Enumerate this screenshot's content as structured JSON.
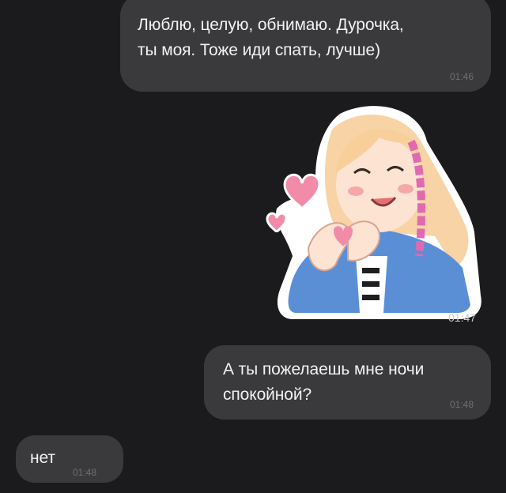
{
  "messages": [
    {
      "id": "msg1",
      "direction": "outgoing",
      "text": "Люблю, целую, обнимаю. Дурочка,\nты моя. Тоже иди спать, лучше)",
      "time": "01:46"
    },
    {
      "id": "msg2",
      "direction": "outgoing",
      "type": "sticker",
      "sticker": "girl-heart-hands-sticker",
      "time": "01:47"
    },
    {
      "id": "msg3",
      "direction": "outgoing",
      "text": "А ты пожелаешь мне ночи\nспокойной?",
      "time": "01:48"
    },
    {
      "id": "msg4",
      "direction": "incoming",
      "text": "нет",
      "time": "01:48"
    }
  ],
  "colors": {
    "background": "#1b1b1d",
    "bubble": "#3a3a3c",
    "text": "#f2f2f2",
    "time": "#6f6f72",
    "heart": "#f28ba8"
  }
}
